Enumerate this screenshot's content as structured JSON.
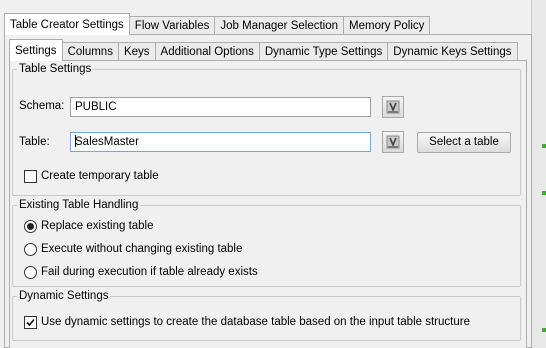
{
  "outer_tabs": [
    "Table Creator Settings",
    "Flow Variables",
    "Job Manager Selection",
    "Memory Policy"
  ],
  "inner_tabs": [
    "Settings",
    "Columns",
    "Keys",
    "Additional Options",
    "Dynamic Type Settings",
    "Dynamic Keys Settings"
  ],
  "table_settings": {
    "title": "Table Settings",
    "schema_label": "Schema:",
    "schema_value": "PUBLIC",
    "table_label": "Table:",
    "table_value": "SalesMaster",
    "select_button": "Select a table",
    "temp_table_label": "Create temporary table",
    "temp_table_checked": false
  },
  "existing_handling": {
    "title": "Existing Table Handling",
    "options": [
      "Replace existing table",
      "Execute without changing existing table",
      "Fail during execution if table already exists"
    ],
    "selected_index": 0
  },
  "dynamic_settings": {
    "title": "Dynamic Settings",
    "checkbox_label": "Use dynamic settings to create the database table based on the input table structure",
    "checked": true
  },
  "icons": {
    "flow_variable": "flow-variable-icon",
    "checkmark": "checkmark-icon"
  },
  "colors": {
    "accent_green": "#3cae2c",
    "panel_bg": "#f0f0f0"
  }
}
